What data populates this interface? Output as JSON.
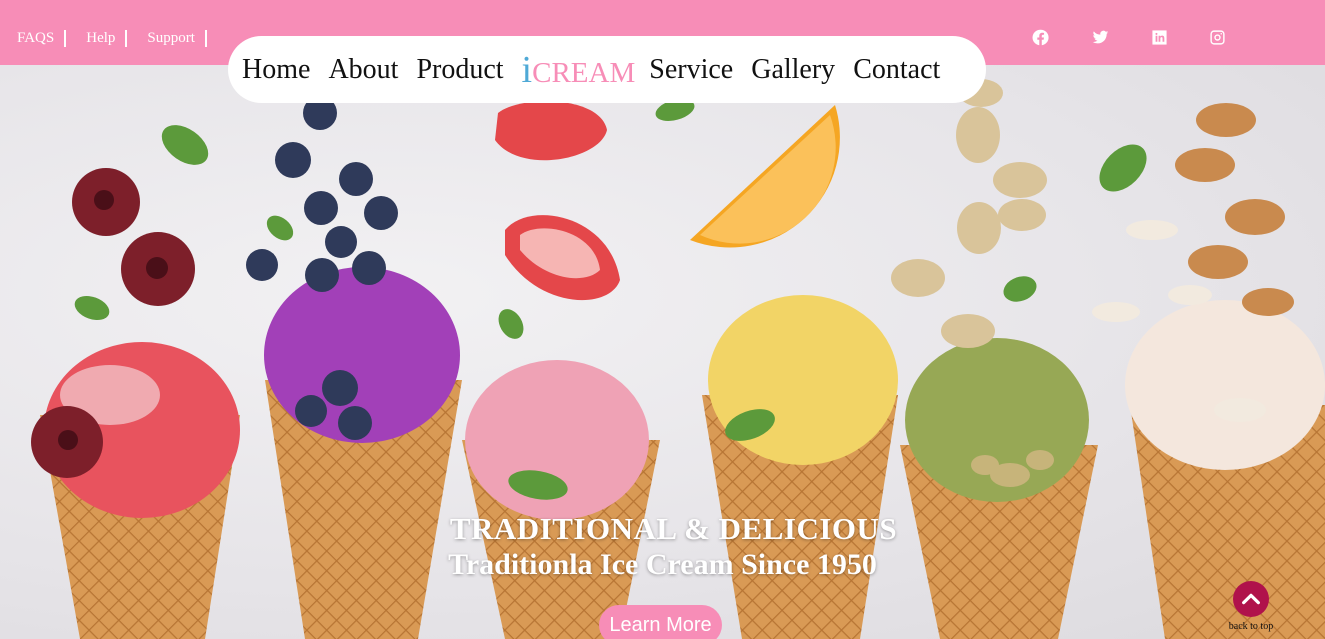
{
  "topbar": {
    "links": [
      "FAQS",
      "Help",
      "Support"
    ],
    "social_icons": [
      "facebook-icon",
      "twitter-icon",
      "linkedin-icon",
      "instagram-icon"
    ],
    "background": "#f78db7"
  },
  "nav": {
    "items_left": [
      "Home",
      "About",
      "Product"
    ],
    "brand_i": "i",
    "brand_rest": "CREAM",
    "items_right": [
      "Service",
      "Gallery",
      "Contact"
    ]
  },
  "hero": {
    "title": "TRADITIONAL & DELICIOUS",
    "subtitle": "Traditionla Ice Cream Since 1950",
    "cta_label": "Learn More",
    "accent": "#f78db7"
  },
  "back_to_top": {
    "label": "back to top",
    "icon": "chevron-up-icon",
    "color": "#b0124b"
  }
}
